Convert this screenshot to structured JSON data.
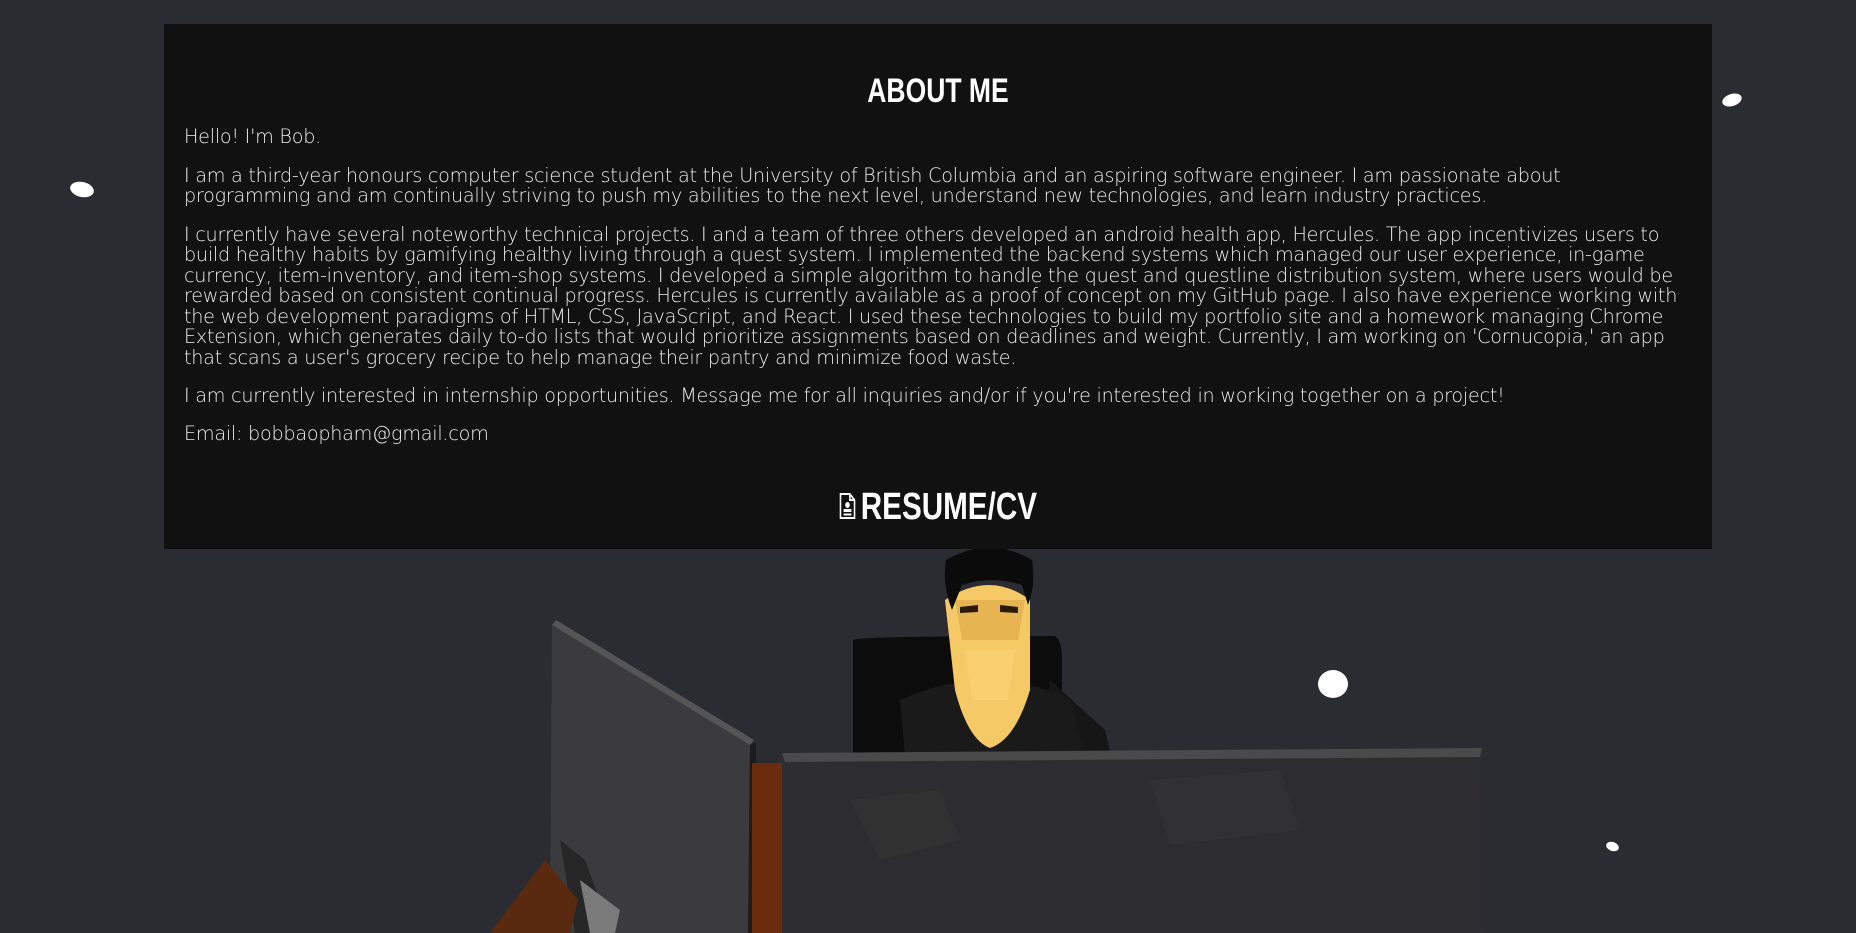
{
  "about": {
    "title": "ABOUT ME",
    "greeting": "Hello! I'm Bob.",
    "paragraph_intro": "I am a third-year honours computer science student at the University of British Columbia and an aspiring software engineer. I am passionate about programming and am continually striving to push my abilities to the next level, understand new technologies, and learn industry practices.",
    "paragraph_projects": "I currently have several noteworthy technical projects. I and a team of three others developed an android health app, Hercules. The app incentivizes users to build healthy habits by gamifying healthy living through a quest system. I implemented the backend systems which managed our user experience, in-game currency, item-inventory, and item-shop systems. I developed a simple algorithm to handle the quest and questline distribution system, where users would be rewarded based on consistent continual progress. Hercules is currently available as a proof of concept on my GitHub page. I also have experience working with the web development paradigms of HTML, CSS, JavaScript, and React. I used these technologies to build my portfolio site and a homework managing Chrome Extension, which generates daily to-do lists that would prioritize assignments based on deadlines and weight. Currently, I am working on 'Cornucopia,' an app that scans a user's grocery recipe to help manage their pantry and minimize food waste.",
    "paragraph_interest": "I am currently interested in internship opportunities. Message me for all inquiries and/or if you're interested in working together on a project!",
    "email": "Email: bobbaopham@gmail.com"
  },
  "resume": {
    "label": "RESUME/CV",
    "icon": "document-icon"
  },
  "colors": {
    "background": "#2a2c31",
    "panel": "#111111",
    "text": "#ececec",
    "skin": "#f2c35a",
    "wood": "#5a2a10"
  }
}
